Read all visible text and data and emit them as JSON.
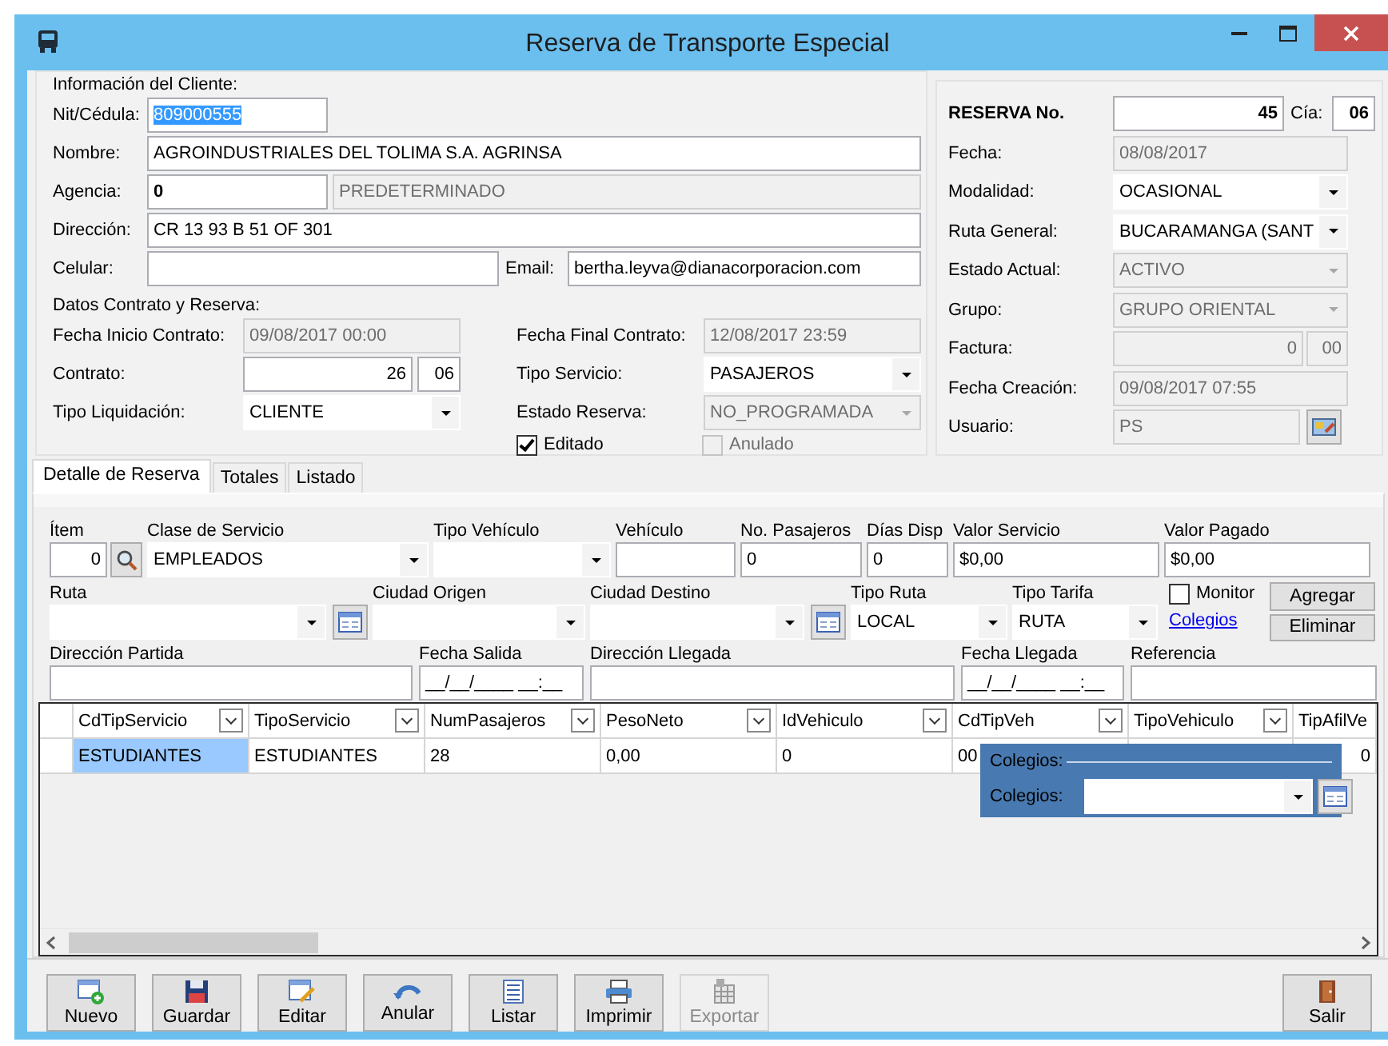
{
  "window": {
    "title": "Reserva de Transporte Especial"
  },
  "client": {
    "legend": "Información del Cliente:",
    "nit": {
      "label": "Nit/Cédula:",
      "value": "809000555",
      "selected": true
    },
    "nombre": {
      "label": "Nombre:",
      "value": "AGROINDUSTRIALES DEL TOLIMA S.A. AGRINSA"
    },
    "agencia": {
      "label": "Agencia:",
      "fields": [
        {
          "value": "0",
          "disabled": false
        },
        {
          "value": "PREDETERMINADO",
          "disabled": true
        }
      ]
    },
    "direccion": {
      "label": "Dirección:",
      "value": "CR 13 93 B 51 OF 301"
    },
    "celular": {
      "label": "Celular:"
    },
    "email": {
      "label": "Email:",
      "value": "bertha.leyva@dianacorporacion.com"
    }
  },
  "contract": {
    "legend": "Datos Contrato y Reserva:",
    "fecha_inicio": {
      "label": "Fecha Inicio Contrato:",
      "value": "09/08/2017 00:00",
      "disabled": true
    },
    "fecha_final": {
      "label": "Fecha Final Contrato:",
      "value": "12/08/2017 23:59",
      "disabled": true
    },
    "contrato": {
      "label": "Contrato:",
      "fields": [
        {
          "value": "26"
        },
        {
          "value": "06"
        }
      ]
    },
    "tipo_servicio": {
      "label": "Tipo Servicio:",
      "value": "PASAJEROS",
      "kind": "combo",
      "disabled": false
    },
    "tipo_liquidacion": {
      "label": "Tipo Liquidación:",
      "value": "CLIENTE",
      "kind": "combo",
      "disabled": false
    },
    "estado_reserva": {
      "label": "Estado Reserva:",
      "value": "NO_PROGRAMADA",
      "kind": "combo",
      "disabled": true
    },
    "checks": [
      {
        "label": "Editado",
        "checked": true,
        "disabled": false
      },
      {
        "label": "Anulado",
        "checked": false,
        "disabled": true
      }
    ]
  },
  "reserva": {
    "numero": {
      "label": "RESERVA No.",
      "value": "45"
    },
    "cia": {
      "label": "Cía:",
      "value": "06"
    },
    "fields": [
      {
        "label": "Fecha:",
        "value": "08/08/2017",
        "kind": "text",
        "disabled": true
      },
      {
        "label": "Modalidad:",
        "value": "OCASIONAL",
        "kind": "combo",
        "disabled": false
      },
      {
        "label": "Ruta General:",
        "value": "BUCARAMANGA (SANT",
        "kind": "combo",
        "disabled": false
      },
      {
        "label": "Estado Actual:",
        "value": "ACTIVO",
        "kind": "combo",
        "disabled": true
      },
      {
        "label": "Grupo:",
        "value": "GRUPO ORIENTAL",
        "kind": "combo",
        "disabled": true
      },
      {
        "label": "Factura:",
        "value": "0",
        "suffix": "00",
        "kind": "split",
        "disabled": true
      },
      {
        "label": "Fecha Creación:",
        "value": "09/08/2017 07:55",
        "kind": "text",
        "disabled": true
      },
      {
        "label": "Usuario:",
        "value": "PS",
        "kind": "lookup",
        "disabled": true
      }
    ]
  },
  "tabs": [
    {
      "label": "Detalle de Reserva",
      "selected": true
    },
    {
      "label": "Totales",
      "selected": false
    },
    {
      "label": "Listado",
      "selected": false
    }
  ],
  "detail": {
    "row1": [
      {
        "label": "Ítem",
        "value": "0",
        "kind": "search"
      },
      {
        "label": "Clase de Servicio",
        "value": "EMPLEADOS",
        "kind": "combo"
      },
      {
        "label": "Tipo Vehículo",
        "kind": "combo"
      },
      {
        "label": "Vehículo",
        "kind": "text"
      },
      {
        "label": "No. Pasajeros",
        "value": "0",
        "kind": "text"
      },
      {
        "label": "Días Disp",
        "value": "0",
        "kind": "text"
      },
      {
        "label": "Valor Servicio",
        "value": "$0,00",
        "kind": "text"
      },
      {
        "label": "Valor Pagado",
        "value": "$0,00",
        "kind": "text"
      }
    ],
    "row2": [
      {
        "label": "Ruta",
        "kind": "combo_lookup"
      },
      {
        "label": "Ciudad Origen",
        "kind": "combo"
      },
      {
        "label": "Ciudad Destino",
        "kind": "combo_lookup"
      },
      {
        "label": "Tipo Ruta",
        "value": "LOCAL",
        "kind": "combo"
      },
      {
        "label": "Tipo Tarifa",
        "value": "RUTA",
        "kind": "combo"
      }
    ],
    "monitor": {
      "label": "Monitor",
      "checked": false
    },
    "link": "Colegios",
    "buttons": [
      "Agregar",
      "Eliminar"
    ],
    "row3": [
      {
        "label": "Dirección Partida",
        "kind": "text"
      },
      {
        "label": "Fecha Salida",
        "value": "__/__/____ __:__",
        "kind": "text"
      },
      {
        "label": "Dirección Llegada",
        "kind": "text"
      },
      {
        "label": "Fecha Llegada",
        "value": "__/__/____ __:__",
        "kind": "text"
      },
      {
        "label": "Referencia",
        "kind": "text"
      }
    ]
  },
  "grid": {
    "columns": [
      "CdTipServicio",
      "TipoServicio",
      "NumPasajeros",
      "PesoNeto",
      "IdVehiculo",
      "CdTipVeh",
      "TipoVehiculo",
      "TipAfilVe"
    ],
    "rows": [
      {
        "cells": [
          {
            "text": "ESTUDIANTES",
            "selected": true
          },
          {
            "text": "ESTUDIANTES",
            "selected": false
          },
          {
            "text": "28",
            "selected": false
          },
          {
            "text": "0,00",
            "selected": false
          },
          {
            "text": "0",
            "selected": false
          },
          {
            "text": "00",
            "selected": false
          },
          {
            "selected": false
          },
          {
            "text": "0",
            "selected": false
          }
        ]
      }
    ]
  },
  "overlay": {
    "legend": "Colegios:",
    "label": "Colegios:"
  },
  "toolbar": [
    {
      "label": "Nuevo",
      "disabled": false
    },
    {
      "label": "Guardar",
      "disabled": false
    },
    {
      "label": "Editar",
      "disabled": false
    },
    {
      "label": "Anular",
      "disabled": false
    },
    {
      "label": "Listar",
      "disabled": false
    },
    {
      "label": "Imprimir",
      "disabled": false
    },
    {
      "label": "Exportar",
      "disabled": true
    }
  ],
  "exit": {
    "label": "Salir"
  }
}
